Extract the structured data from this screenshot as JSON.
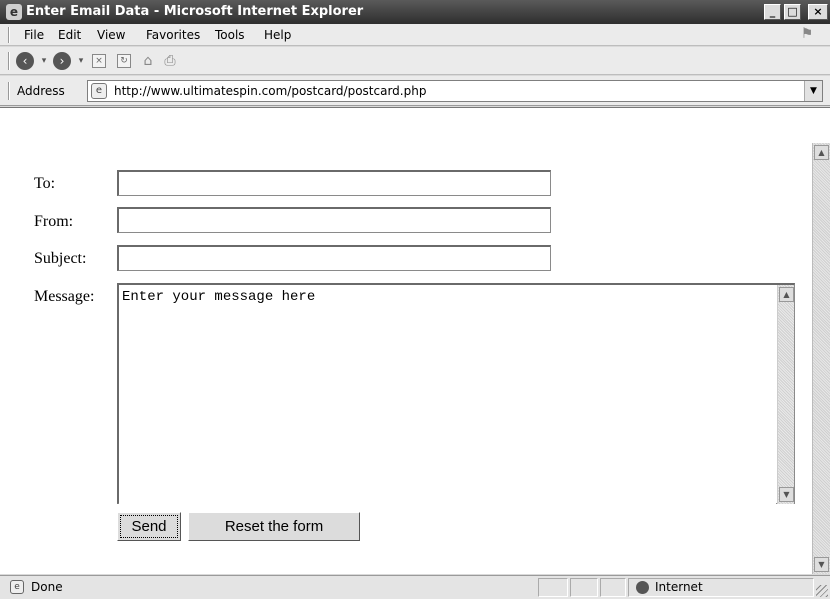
{
  "window": {
    "title": "Enter Email Data - Microsoft Internet Explorer",
    "minimize_glyph": "_",
    "maximize_glyph": "□",
    "close_glyph": "×"
  },
  "menu": {
    "items": [
      "File",
      "Edit",
      "View",
      "Favorites",
      "Tools",
      "Help"
    ]
  },
  "toolbar": {
    "icons": [
      "back-icon",
      "forward-icon",
      "stop-icon",
      "refresh-icon",
      "home-icon",
      "print-icon"
    ]
  },
  "address": {
    "label": "Address",
    "url": "http://www.ultimatespin.com/postcard/postcard.php"
  },
  "form": {
    "to_label": "To:",
    "to_value": "",
    "from_label": "From:",
    "from_value": "",
    "subject_label": "Subject:",
    "subject_value": "",
    "message_label": "Message:",
    "message_value": "Enter your message here",
    "send_label": "Send",
    "reset_label": "Reset the form"
  },
  "status": {
    "text": "Done",
    "zone": "Internet"
  }
}
